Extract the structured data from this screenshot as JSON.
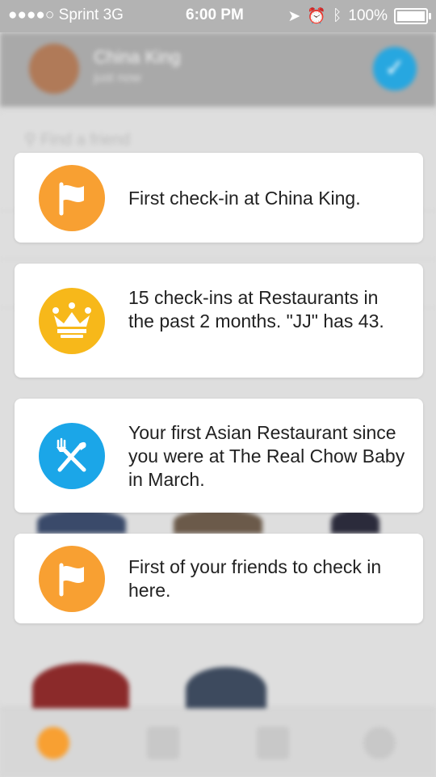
{
  "status_bar": {
    "carrier": "●●●●○ Sprint  3G",
    "time": "6:00 PM",
    "battery": "100%"
  },
  "header": {
    "name": "China King",
    "subtitle": "just now"
  },
  "search": {
    "placeholder": "Find a friend"
  },
  "cards": [
    {
      "icon": "flag-icon",
      "color": "#f8a032",
      "text": "First check-in at China King."
    },
    {
      "icon": "crown-icon",
      "color": "#f7b81a",
      "text": "15 check-ins at Restaurants in the past 2 months. \"JJ\" has 43."
    },
    {
      "icon": "fork-knife-icon",
      "color": "#1ba6e8",
      "text": "Your first Asian Restaurant since you were at The Real Chow Baby in March."
    },
    {
      "icon": "flag-icon",
      "color": "#f8a032",
      "text": "First of your friends to check in here."
    }
  ],
  "tabbar": {
    "items": [
      "home-icon",
      "list-icon",
      "calendar-icon",
      "profile-icon"
    ]
  }
}
